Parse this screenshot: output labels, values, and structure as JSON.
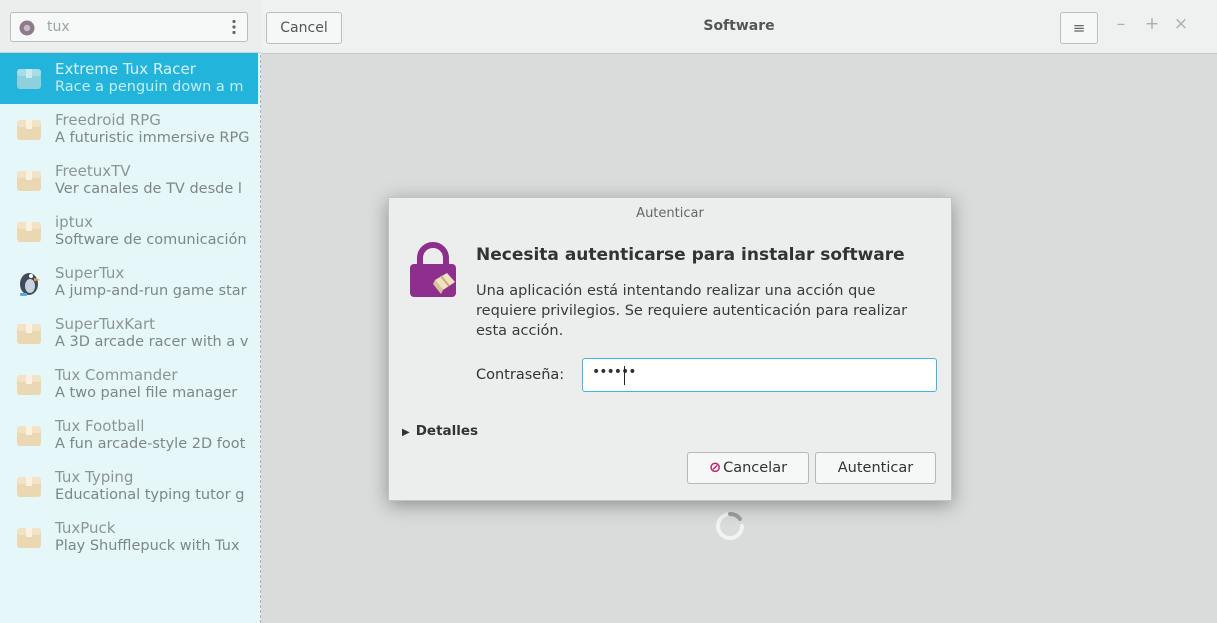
{
  "sidebar": {
    "search": {
      "value": "tux"
    },
    "items": [
      {
        "name": "Extreme Tux Racer",
        "desc": "Race a penguin down a m",
        "selected": true
      },
      {
        "name": "Freedroid RPG",
        "desc": "A futuristic immersive RPG"
      },
      {
        "name": "FreetuxTV",
        "desc": "Ver canales de TV desde l"
      },
      {
        "name": "iptux",
        "desc": "Software de comunicación"
      },
      {
        "name": "SuperTux",
        "desc": "A jump-and-run game star"
      },
      {
        "name": "SuperTuxKart",
        "desc": "A 3D arcade racer with a v"
      },
      {
        "name": "Tux Commander",
        "desc": "A two panel file manager"
      },
      {
        "name": "Tux Football",
        "desc": "A fun arcade-style 2D foot"
      },
      {
        "name": "Tux Typing",
        "desc": "Educational typing tutor g"
      },
      {
        "name": "TuxPuck",
        "desc": "Play Shufflepuck with Tux"
      }
    ]
  },
  "header": {
    "cancel_label": "Cancel",
    "title": "Software"
  },
  "dialog": {
    "title": "Autenticar",
    "heading": "Necesita autenticarse para instalar software",
    "body": "Una aplicación está intentando realizar una acción que requiere privilegios. Se requiere autenticación para realizar esta acción.",
    "password_label": "Contraseña:",
    "password_mask": "••••••",
    "details_label": "Detalles",
    "cancel_label": "Cancelar",
    "auth_label": "Autenticar"
  },
  "colors": {
    "selection": "#23b4dc",
    "lock": "#8e2f8e",
    "focus_border": "#3fb6de",
    "cancel_glyph": "#c01f6f"
  }
}
